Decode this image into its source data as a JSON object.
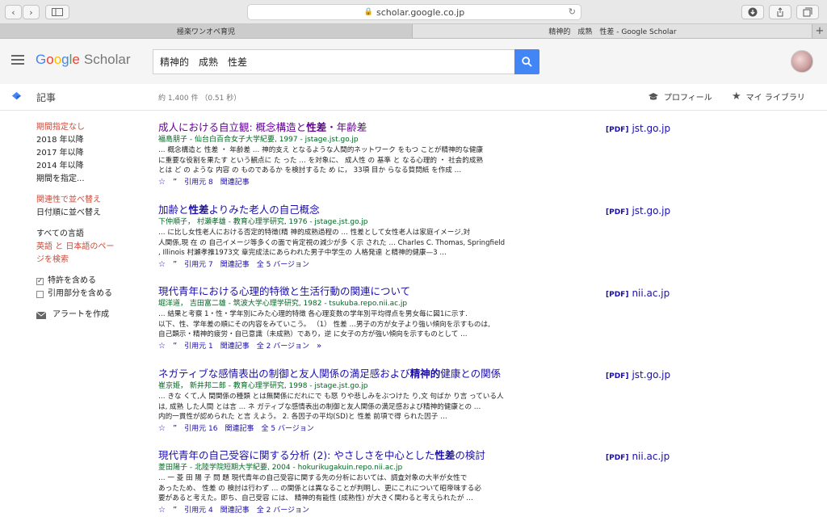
{
  "browser": {
    "url": "scholar.google.co.jp",
    "tabs": [
      {
        "label": "極楽ワンオペ育児"
      },
      {
        "label": "精神的　成熟　性差 - Google Scholar"
      }
    ]
  },
  "header": {
    "logo_scholar": "Scholar",
    "search_value": "精神的　成熟　性差"
  },
  "subbar": {
    "title": "記事",
    "result_count": "約 1,400 件 （0.51 秒）",
    "profile": "プロフィール",
    "library": "マイ ライブラリ"
  },
  "sidebar": {
    "time_filters": [
      "期間指定なし",
      "2018 年以降",
      "2017 年以降",
      "2014 年以降",
      "期間を指定..."
    ],
    "sort": [
      "関連性で並べ替え",
      "日付順に並べ替え"
    ],
    "languages": [
      "すべての言語",
      "英語 と 日本語のペー",
      "ジを検索"
    ],
    "patents": "特許を含める",
    "citations": "引用部分を含める",
    "alert": "アラートを作成"
  },
  "results": [
    {
      "title_pre": "成人における自立観: 概念構造と",
      "title_bold": "性差",
      "title_post": "・年齢差",
      "meta": "福島朋子 - 仙台白百合女子大学紀要, 1997 - jstage.jst.go.jp",
      "snippet": [
        "… 概念構造と 性差 ・ 年齢差 … 神的支え となるような人間的ネットワーク をもつ ことが精神的な健康",
        "に重要な役割を果たす という観点に た った … を対象に、 成人性 の 基準 と なる心理的 ・ 社会的成熟",
        "とは ど の ような 内容 の ものであるか を検討するた め に， 33項 目か らなる質問紙 を作成 …"
      ],
      "cited": "引用元 8",
      "related": "関連記事",
      "versions": "",
      "pdf_domain": "jst.go.jp"
    },
    {
      "title_pre": "加齢と",
      "title_bold": "性差",
      "title_post": "よりみた老人の自己概念",
      "meta": "下仲順子， 村瀬孝雄 - 教育心理学研究, 1976 - jstage.jst.go.jp",
      "snippet": [
        "… に比し女性老人における否定的特徴(精 神的成熟過程の … 性差として女性老人は家庭イメージ,対",
        "人関係,現 在 の 自己イメージ等多くの面で肯定視の減少が多 く示 された … Charles C. Thomas, Springfield",
        ", Illinois 村瀬孝推1973文 章完成法にあらわれた男子中学生の 人格発達 と精神的健康—3 …"
      ],
      "cited": "引用元 7",
      "related": "関連記事",
      "versions": "全 5 バージョン",
      "pdf_domain": "jst.go.jp"
    },
    {
      "title_pre": "現代青年における心理的特徴と生活行動の関連について",
      "title_bold": "",
      "title_post": "",
      "meta": "堀洋道， 吉田富二雄 - 筑波大学心理学研究, 1982 - tsukuba.repo.nii.ac.jp",
      "snippet": [
        "… 結果と考察 1・性・学年別にみた心理的特徴 各心理変数の学年別平均得点を男女毎に図1に示す.",
        "以下、性、学年差の順にその内容をみていこう。 （1） 性差 …男子の方が女子より強い傾向を示すものは,",
        "自己顕示・精神的疲労・自已意識（未成熟）であり，逆 に女子の方が強い傾向を示すものとして …"
      ],
      "cited": "引用元 1",
      "related": "関連記事",
      "versions": "全 2 バージョン",
      "pdf_domain": "nii.ac.jp"
    },
    {
      "title_pre": "ネガティブな感情表出の制御と友人関係の満足感および",
      "title_bold": "精神的",
      "title_post": "健康との関係",
      "meta": "崔京姫， 新井邦二郎 - 教育心理学研究, 1998 - jstage.jst.go.jp",
      "snippet": [
        "… きな くて,人 間関係の種類 とは無関係にだれにで も怒 りや悲しみをぶつけた り,文 句ばか り言 っている人",
        "は, 成熟 した人間 とは言 … ネ ガティブな感情表出の制御と友人関係の満足感および精神的健康との …",
        "内的一貫性が認められた と言 えよう。 2. 各因子の平均(SD)と 性差 前項で得 られた因子 …"
      ],
      "cited": "引用元 16",
      "related": "関連記事",
      "versions": "全 5 バージョン",
      "pdf_domain": "jst.go.jp"
    },
    {
      "title_pre": "現代青年の自己受容に関する分析 (2): やさしさを中心とした",
      "title_bold": "性差",
      "title_post": "の検討",
      "meta": "菱田陽子 - 北陸学院短期大学紀要, 2004 - hokurikugakuin.repo.nii.ac.jp",
      "snippet": [
        "… 一 菱 田 陽 子 問 題 現代青年の自己受容に関する先の分析においては、調査対象の大半が女性で",
        "あったため、 性差 の 検討は行わず … の関係とは異なることが判明し、更にこれについて昭帝味する必",
        "要があると考えた。即ち、自己受容 には、 精神的有能性 (成熟性) が大きく関わると考えられたが …"
      ],
      "cited": "引用元 4",
      "related": "関連記事",
      "versions": "全 2 バージョン",
      "pdf_domain": "nii.ac.jp"
    }
  ],
  "pdf_tag": "[PDF]",
  "colors": {
    "link": "#1a0dab",
    "visited": "#660099",
    "meta": "#006621",
    "accent_red": "#d14836",
    "search_button": "#4285f4"
  }
}
